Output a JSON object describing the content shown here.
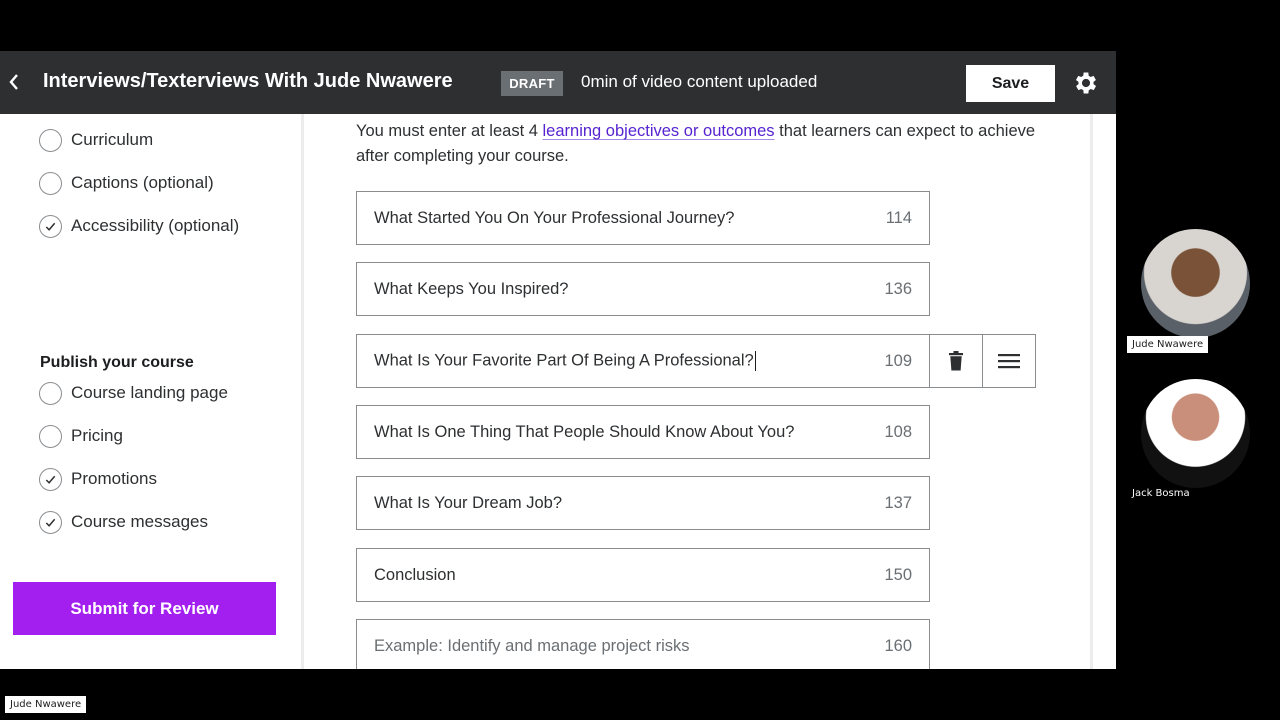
{
  "header": {
    "back_icon": "chevron-left-icon",
    "course_title": "Interviews/Texterviews With Jude Nwawere",
    "status_badge": "DRAFT",
    "upload_status": "0min of video content uploaded",
    "save_label": "Save",
    "settings_icon": "gear-icon"
  },
  "sidebar": {
    "create_items": [
      {
        "label": "Curriculum",
        "checked": false
      },
      {
        "label": "Captions (optional)",
        "checked": false
      },
      {
        "label": "Accessibility (optional)",
        "checked": true
      }
    ],
    "publish_heading": "Publish your course",
    "publish_items": [
      {
        "label": "Course landing page",
        "checked": false
      },
      {
        "label": "Pricing",
        "checked": false
      },
      {
        "label": "Promotions",
        "checked": true
      },
      {
        "label": "Course messages",
        "checked": true
      }
    ],
    "submit_label": "Submit for Review"
  },
  "main": {
    "intro_before": "You must enter at least 4 ",
    "intro_link": "learning objectives or outcomes",
    "intro_after": " that learners can expect to achieve after completing your course.",
    "objectives": [
      {
        "value": "What Started You On Your Professional Journey?",
        "remaining": "114"
      },
      {
        "value": "What Keeps You Inspired?",
        "remaining": "136"
      },
      {
        "value": "What Is Your Favorite Part Of Being A Professional?",
        "remaining": "109",
        "focused": true
      },
      {
        "value": "What Is One Thing That People Should Know About You?",
        "remaining": "108"
      },
      {
        "value": "What Is Your Dream Job?",
        "remaining": "137"
      },
      {
        "value": "Conclusion",
        "remaining": "150"
      }
    ],
    "new_objective": {
      "placeholder": "Example: Identify and manage project risks",
      "remaining": "160"
    },
    "row_actions": {
      "delete_icon": "trash-icon",
      "reorder_icon": "drag-handle-icon"
    }
  },
  "call": {
    "participants": [
      {
        "name": "Jude Nwawere"
      },
      {
        "name": "Jack Bosma"
      }
    ],
    "self_view_name": "Jude Nwawere"
  },
  "colors": {
    "topbar": "#2d2f31",
    "accent_purple": "#a31ff0",
    "link": "#5624d0",
    "badge": "#6a6f73"
  }
}
